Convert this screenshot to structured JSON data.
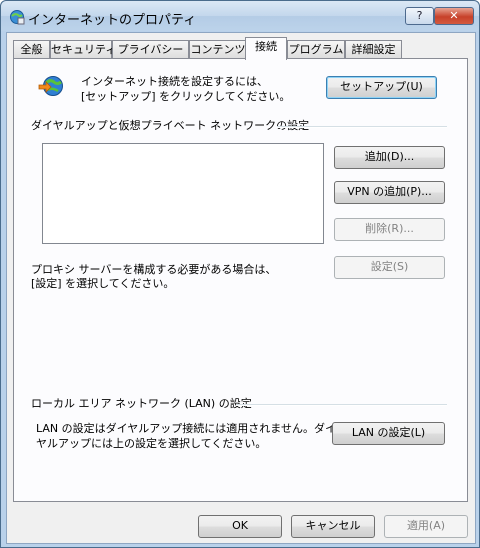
{
  "window": {
    "title": "インターネットのプロパティ",
    "help_label": "?",
    "close_label": "✕"
  },
  "tabs": [
    {
      "label": "全般"
    },
    {
      "label": "セキュリティ"
    },
    {
      "label": "プライバシー"
    },
    {
      "label": "コンテンツ"
    },
    {
      "label": "接続"
    },
    {
      "label": "プログラム"
    },
    {
      "label": "詳細設定"
    }
  ],
  "setup": {
    "line1": "インターネット接続を設定するには、",
    "line2": "[セットアップ] をクリックしてください。",
    "button": "セットアップ(U)"
  },
  "dialup": {
    "heading": "ダイヤルアップと仮想プライベート ネットワークの設定",
    "add_button": "追加(D)...",
    "vpn_button": "VPN の追加(P)...",
    "remove_button": "削除(R)...",
    "settings_button": "設定(S)",
    "proxy_line1": "プロキシ サーバーを構成する必要がある場合は、",
    "proxy_line2": "[設定] を選択してください。"
  },
  "lan": {
    "heading": "ローカル エリア ネットワーク (LAN) の設定",
    "line1": "LAN の設定はダイヤルアップ接続には適用されません。ダイ",
    "line2": "ヤルアップには上の設定を選択してください。",
    "button": "LAN の設定(L)"
  },
  "footer": {
    "ok": "OK",
    "cancel": "キャンセル",
    "apply": "適用(A)"
  }
}
